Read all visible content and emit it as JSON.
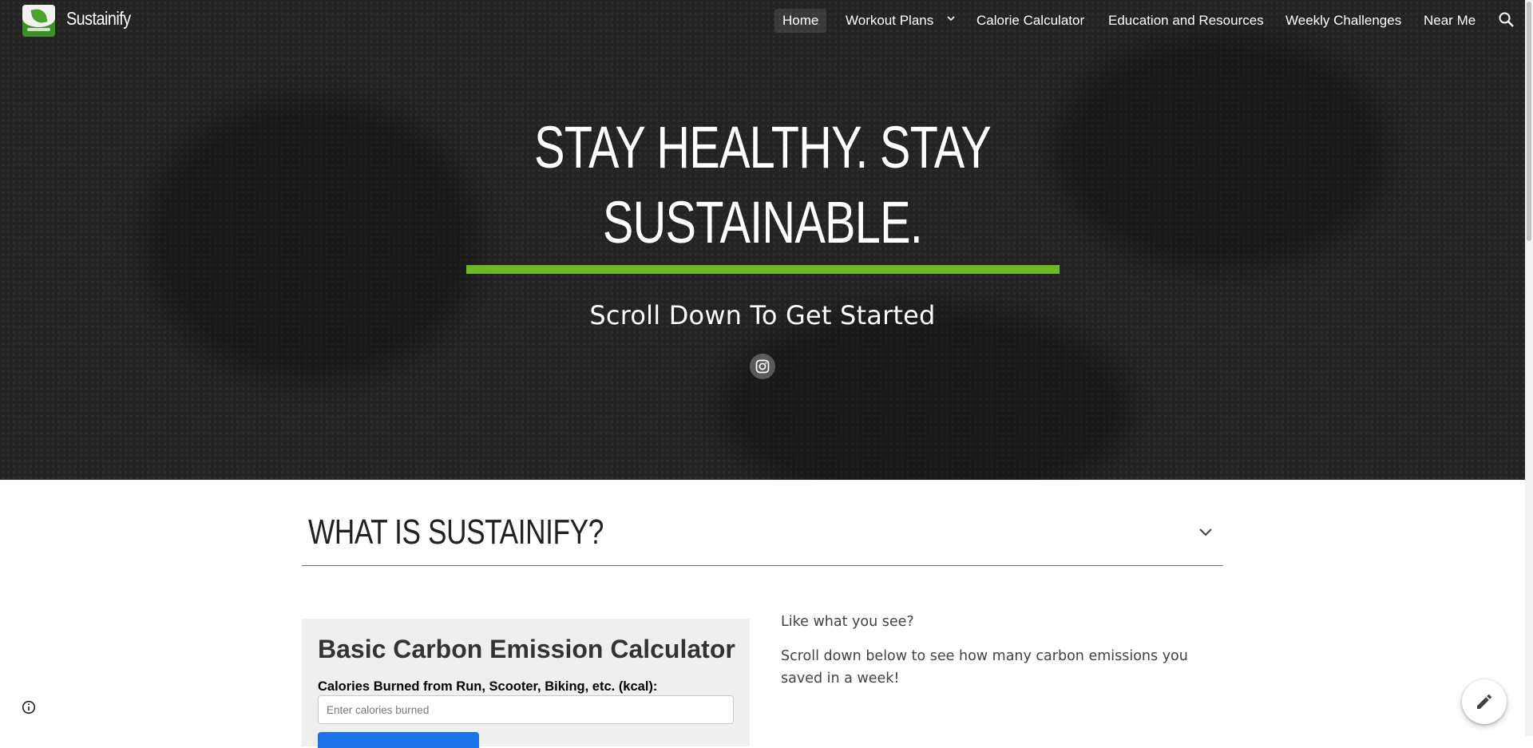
{
  "site": {
    "title": "Sustainify",
    "logo_icon": "sustainify-leaf-logo"
  },
  "nav": {
    "items": [
      {
        "label": "Home",
        "active": true
      },
      {
        "label": "Workout Plans",
        "has_dropdown": true
      },
      {
        "label": "Calorie Calculator"
      },
      {
        "label": "Education and Resources"
      },
      {
        "label": "Weekly Challenges"
      },
      {
        "label": "Near Me"
      }
    ],
    "search_icon": "search-icon"
  },
  "hero": {
    "title_line1": "STAY HEALTHY. STAY",
    "title_line2": "SUSTAINABLE.",
    "subtitle": "Scroll Down To Get Started",
    "social_icon": "instagram-icon",
    "accent_color": "#6fb825"
  },
  "section": {
    "title": "WHAT IS SUSTAINIFY?",
    "toggle_icon": "chevron-down-icon"
  },
  "calculator": {
    "title": "Basic Carbon Emission Calculator",
    "label": "Calories Burned from Run, Scooter, Biking, etc. (kcal):",
    "input_placeholder": "Enter calories burned",
    "input_value": "",
    "button_color": "#1a73e8"
  },
  "sidebar_text": {
    "line1": "Like what you see?",
    "line2": "Scroll down below to see how many carbon emissions you saved in a week!"
  },
  "footer": {
    "info_icon": "info-icon",
    "edit_icon": "pencil-edit-icon"
  }
}
